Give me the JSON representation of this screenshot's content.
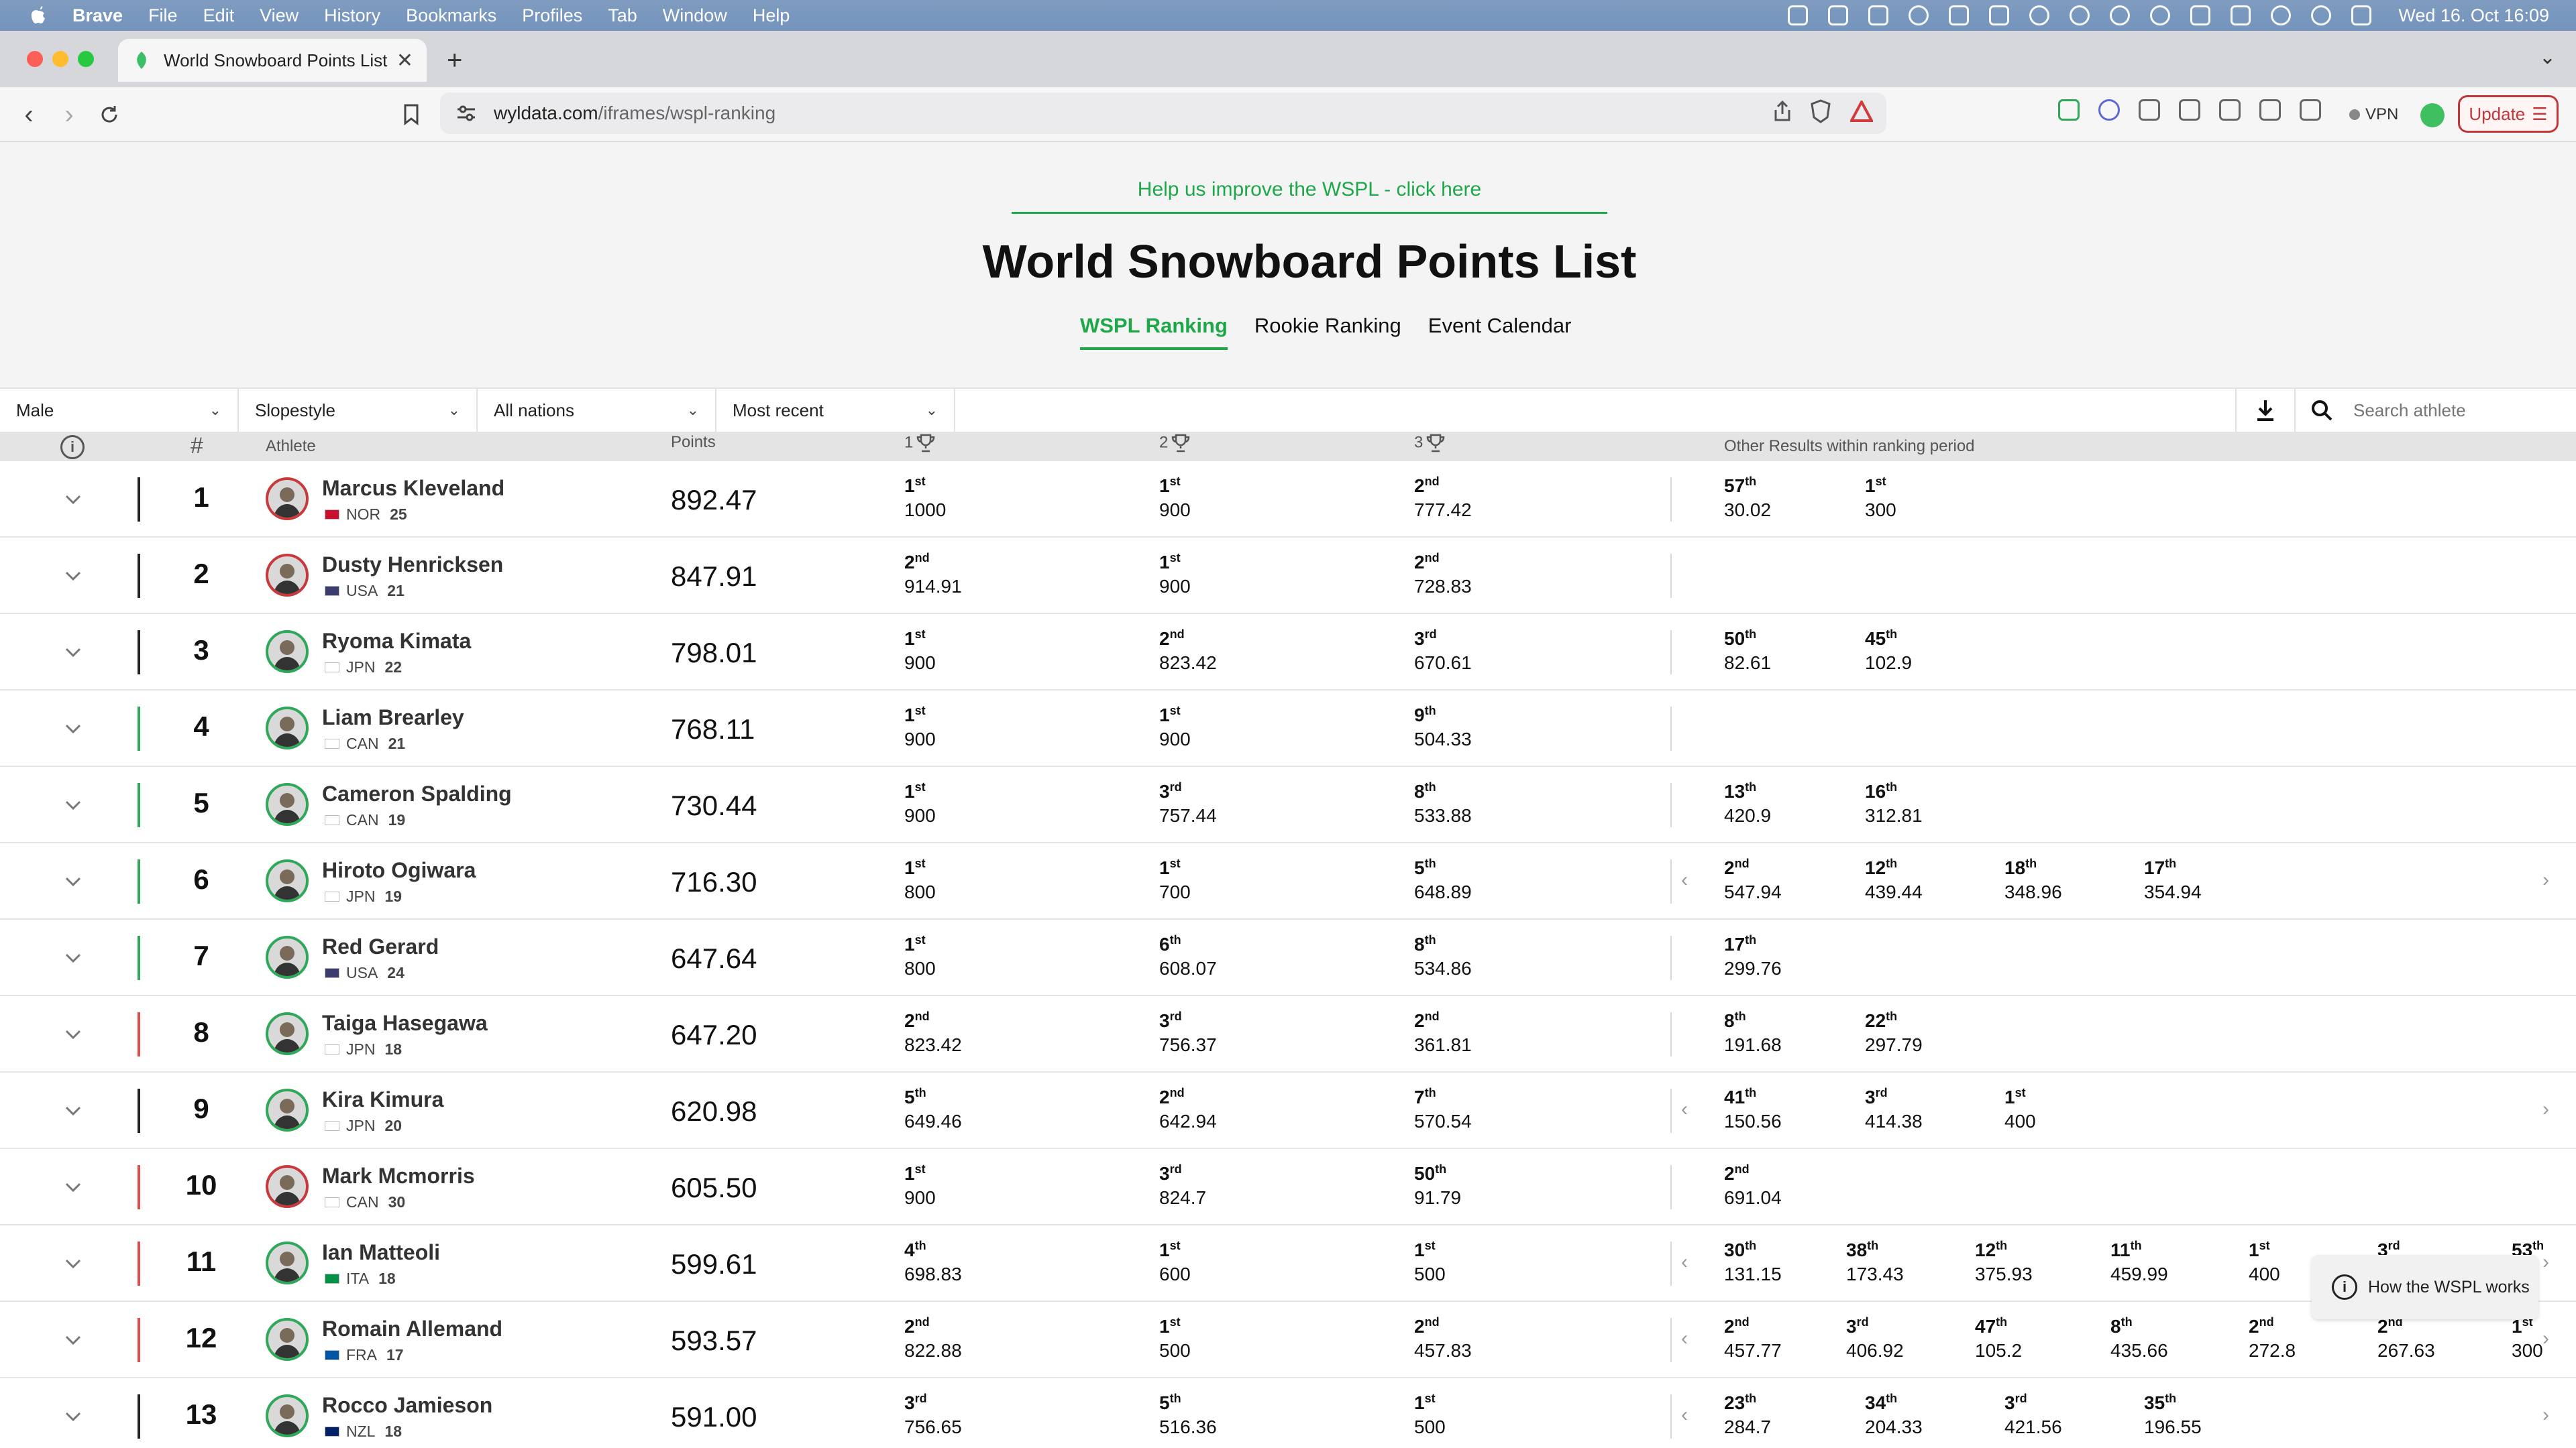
{
  "menubar": {
    "app_name": "Brave",
    "items": [
      "File",
      "Edit",
      "View",
      "History",
      "Bookmarks",
      "Profiles",
      "Tab",
      "Window",
      "Help"
    ],
    "clock": "Wed 16. Oct  16:09"
  },
  "browser": {
    "tab_title": "World Snowboard Points List",
    "url_domain": "wyldata.com",
    "url_path": "/iframes/wspl-ranking",
    "vpn_label": "VPN",
    "update_label": "Update"
  },
  "page": {
    "help_link": "Help us improve the WSPL - click here",
    "title": "World Snowboard Points List",
    "tabs": [
      "WSPL Ranking",
      "Rookie Ranking",
      "Event Calendar"
    ],
    "active_tab": "WSPL Ranking"
  },
  "filters": {
    "gender": "Male",
    "discipline": "Slopestyle",
    "nation": "All nations",
    "sort": "Most recent",
    "search_placeholder": "Search athlete"
  },
  "table_header": {
    "rank": "#",
    "athlete": "Athlete",
    "points": "Points",
    "best1": "1",
    "best2": "2",
    "best3": "3",
    "other": "Other Results within ranking period"
  },
  "colors": {
    "accent_green": "#1ea84a",
    "trend_up": "#2fa85a",
    "trend_down": "#e04b4b",
    "trend_neutral": "#222222"
  },
  "athletes": [
    {
      "rank": "1",
      "name": "Marcus Kleveland",
      "nation": "NOR",
      "age": "25",
      "points": "892.47",
      "trend": "neutral",
      "avatar_ring": "red",
      "best": [
        {
          "place": "1",
          "suffix": "st",
          "pts": "1000"
        },
        {
          "place": "1",
          "suffix": "st",
          "pts": "900"
        },
        {
          "place": "2",
          "suffix": "nd",
          "pts": "777.42"
        }
      ],
      "other": [
        {
          "place": "57",
          "suffix": "th",
          "pts": "30.02"
        },
        {
          "place": "1",
          "suffix": "st",
          "pts": "300"
        }
      ],
      "other_arrows": false
    },
    {
      "rank": "2",
      "name": "Dusty Henricksen",
      "nation": "USA",
      "age": "21",
      "points": "847.91",
      "trend": "neutral",
      "avatar_ring": "red",
      "best": [
        {
          "place": "2",
          "suffix": "nd",
          "pts": "914.91"
        },
        {
          "place": "1",
          "suffix": "st",
          "pts": "900"
        },
        {
          "place": "2",
          "suffix": "nd",
          "pts": "728.83"
        }
      ],
      "other": [],
      "other_arrows": false
    },
    {
      "rank": "3",
      "name": "Ryoma Kimata",
      "nation": "JPN",
      "age": "22",
      "points": "798.01",
      "trend": "neutral",
      "avatar_ring": "green",
      "best": [
        {
          "place": "1",
          "suffix": "st",
          "pts": "900"
        },
        {
          "place": "2",
          "suffix": "nd",
          "pts": "823.42"
        },
        {
          "place": "3",
          "suffix": "rd",
          "pts": "670.61"
        }
      ],
      "other": [
        {
          "place": "50",
          "suffix": "th",
          "pts": "82.61"
        },
        {
          "place": "45",
          "suffix": "th",
          "pts": "102.9"
        }
      ],
      "other_arrows": false
    },
    {
      "rank": "4",
      "name": "Liam Brearley",
      "nation": "CAN",
      "age": "21",
      "points": "768.11",
      "trend": "up",
      "avatar_ring": "green",
      "best": [
        {
          "place": "1",
          "suffix": "st",
          "pts": "900"
        },
        {
          "place": "1",
          "suffix": "st",
          "pts": "900"
        },
        {
          "place": "9",
          "suffix": "th",
          "pts": "504.33"
        }
      ],
      "other": [],
      "other_arrows": false
    },
    {
      "rank": "5",
      "name": "Cameron Spalding",
      "nation": "CAN",
      "age": "19",
      "points": "730.44",
      "trend": "up",
      "avatar_ring": "green",
      "best": [
        {
          "place": "1",
          "suffix": "st",
          "pts": "900"
        },
        {
          "place": "3",
          "suffix": "rd",
          "pts": "757.44"
        },
        {
          "place": "8",
          "suffix": "th",
          "pts": "533.88"
        }
      ],
      "other": [
        {
          "place": "13",
          "suffix": "th",
          "pts": "420.9"
        },
        {
          "place": "16",
          "suffix": "th",
          "pts": "312.81"
        }
      ],
      "other_arrows": false
    },
    {
      "rank": "6",
      "name": "Hiroto Ogiwara",
      "nation": "JPN",
      "age": "19",
      "points": "716.30",
      "trend": "up",
      "avatar_ring": "green",
      "best": [
        {
          "place": "1",
          "suffix": "st",
          "pts": "800"
        },
        {
          "place": "1",
          "suffix": "st",
          "pts": "700"
        },
        {
          "place": "5",
          "suffix": "th",
          "pts": "648.89"
        }
      ],
      "other": [
        {
          "place": "2",
          "suffix": "nd",
          "pts": "547.94"
        },
        {
          "place": "12",
          "suffix": "th",
          "pts": "439.44"
        },
        {
          "place": "18",
          "suffix": "th",
          "pts": "348.96"
        },
        {
          "place": "17",
          "suffix": "th",
          "pts": "354.94"
        }
      ],
      "other_arrows": true
    },
    {
      "rank": "7",
      "name": "Red Gerard",
      "nation": "USA",
      "age": "24",
      "points": "647.64",
      "trend": "up",
      "avatar_ring": "green",
      "best": [
        {
          "place": "1",
          "suffix": "st",
          "pts": "800"
        },
        {
          "place": "6",
          "suffix": "th",
          "pts": "608.07"
        },
        {
          "place": "8",
          "suffix": "th",
          "pts": "534.86"
        }
      ],
      "other": [
        {
          "place": "17",
          "suffix": "th",
          "pts": "299.76"
        }
      ],
      "other_arrows": false
    },
    {
      "rank": "8",
      "name": "Taiga Hasegawa",
      "nation": "JPN",
      "age": "18",
      "points": "647.20",
      "trend": "down",
      "avatar_ring": "green",
      "best": [
        {
          "place": "2",
          "suffix": "nd",
          "pts": "823.42"
        },
        {
          "place": "3",
          "suffix": "rd",
          "pts": "756.37"
        },
        {
          "place": "2",
          "suffix": "nd",
          "pts": "361.81"
        }
      ],
      "other": [
        {
          "place": "8",
          "suffix": "th",
          "pts": "191.68"
        },
        {
          "place": "22",
          "suffix": "th",
          "pts": "297.79"
        }
      ],
      "other_arrows": false
    },
    {
      "rank": "9",
      "name": "Kira Kimura",
      "nation": "JPN",
      "age": "20",
      "points": "620.98",
      "trend": "neutral",
      "avatar_ring": "green",
      "best": [
        {
          "place": "5",
          "suffix": "th",
          "pts": "649.46"
        },
        {
          "place": "2",
          "suffix": "nd",
          "pts": "642.94"
        },
        {
          "place": "7",
          "suffix": "th",
          "pts": "570.54"
        }
      ],
      "other": [
        {
          "place": "41",
          "suffix": "th",
          "pts": "150.56"
        },
        {
          "place": "3",
          "suffix": "rd",
          "pts": "414.38"
        },
        {
          "place": "1",
          "suffix": "st",
          "pts": "400"
        }
      ],
      "other_arrows": true
    },
    {
      "rank": "10",
      "name": "Mark Mcmorris",
      "nation": "CAN",
      "age": "30",
      "points": "605.50",
      "trend": "down",
      "avatar_ring": "red",
      "best": [
        {
          "place": "1",
          "suffix": "st",
          "pts": "900"
        },
        {
          "place": "3",
          "suffix": "rd",
          "pts": "824.7"
        },
        {
          "place": "50",
          "suffix": "th",
          "pts": "91.79"
        }
      ],
      "other": [
        {
          "place": "2",
          "suffix": "nd",
          "pts": "691.04"
        }
      ],
      "other_arrows": false
    },
    {
      "rank": "11",
      "name": "Ian Matteoli",
      "nation": "ITA",
      "age": "18",
      "points": "599.61",
      "trend": "down",
      "avatar_ring": "green",
      "best": [
        {
          "place": "4",
          "suffix": "th",
          "pts": "698.83"
        },
        {
          "place": "1",
          "suffix": "st",
          "pts": "600"
        },
        {
          "place": "1",
          "suffix": "st",
          "pts": "500"
        }
      ],
      "other": [
        {
          "place": "30",
          "suffix": "th",
          "pts": "131.15"
        },
        {
          "place": "38",
          "suffix": "th",
          "pts": "173.43"
        },
        {
          "place": "12",
          "suffix": "th",
          "pts": "375.93"
        },
        {
          "place": "11",
          "suffix": "th",
          "pts": "459.99"
        },
        {
          "place": "1",
          "suffix": "st",
          "pts": "400"
        },
        {
          "place": "3",
          "suffix": "rd",
          "pts": ""
        },
        {
          "place": "53",
          "suffix": "th",
          "pts": ""
        }
      ],
      "other_arrows": true
    },
    {
      "rank": "12",
      "name": "Romain Allemand",
      "nation": "FRA",
      "age": "17",
      "points": "593.57",
      "trend": "down",
      "avatar_ring": "green",
      "best": [
        {
          "place": "2",
          "suffix": "nd",
          "pts": "822.88"
        },
        {
          "place": "1",
          "suffix": "st",
          "pts": "500"
        },
        {
          "place": "2",
          "suffix": "nd",
          "pts": "457.83"
        }
      ],
      "other": [
        {
          "place": "2",
          "suffix": "nd",
          "pts": "457.77"
        },
        {
          "place": "3",
          "suffix": "rd",
          "pts": "406.92"
        },
        {
          "place": "47",
          "suffix": "th",
          "pts": "105.2"
        },
        {
          "place": "8",
          "suffix": "th",
          "pts": "435.66"
        },
        {
          "place": "2",
          "suffix": "nd",
          "pts": "272.8"
        },
        {
          "place": "2",
          "suffix": "nd",
          "pts": "267.63"
        },
        {
          "place": "1",
          "suffix": "st",
          "pts": "300"
        }
      ],
      "other_arrows": true
    },
    {
      "rank": "13",
      "name": "Rocco Jamieson",
      "nation": "NZL",
      "age": "18",
      "points": "591.00",
      "trend": "neutral",
      "avatar_ring": "green",
      "best": [
        {
          "place": "3",
          "suffix": "rd",
          "pts": "756.65"
        },
        {
          "place": "5",
          "suffix": "th",
          "pts": "516.36"
        },
        {
          "place": "1",
          "suffix": "st",
          "pts": "500"
        }
      ],
      "other": [
        {
          "place": "23",
          "suffix": "th",
          "pts": "284.7"
        },
        {
          "place": "34",
          "suffix": "th",
          "pts": "204.33"
        },
        {
          "place": "3",
          "suffix": "rd",
          "pts": "421.56"
        },
        {
          "place": "35",
          "suffix": "th",
          "pts": "196.55"
        }
      ],
      "other_arrows": true
    }
  ],
  "how_box": {
    "label": "How the WSPL works"
  }
}
